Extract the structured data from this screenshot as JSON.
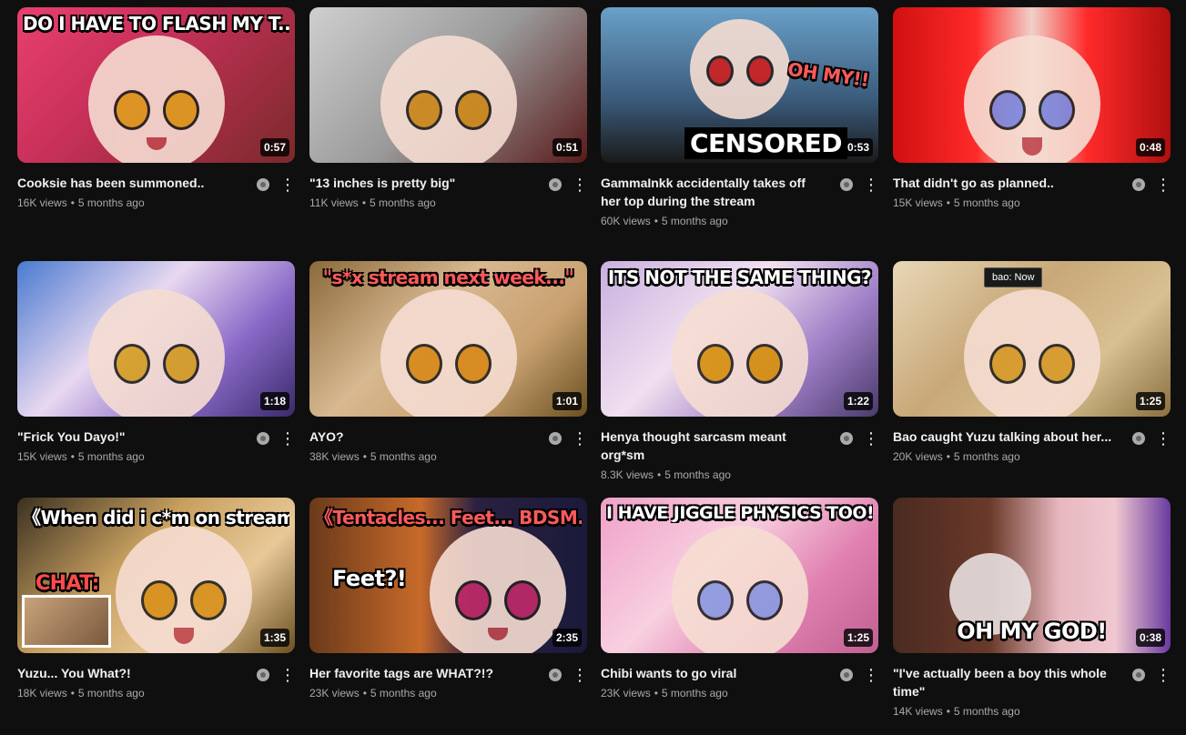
{
  "videos": [
    {
      "title": "Cooksie has been summoned..",
      "views": "16K views",
      "age": "5 months ago",
      "duration": "0:57",
      "caption": "DO I HAVE TO FLASH MY T...?"
    },
    {
      "title": "\"13 inches is pretty big\"",
      "views": "11K views",
      "age": "5 months ago",
      "duration": "0:51",
      "caption": ""
    },
    {
      "title": "GammaInkk accidentally takes off her top during the stream",
      "views": "60K views",
      "age": "5 months ago",
      "duration": "0:53",
      "caption": "OH MY!!",
      "caption2": "CENSORED"
    },
    {
      "title": "That didn't go as planned..",
      "views": "15K views",
      "age": "5 months ago",
      "duration": "0:48",
      "caption": ""
    },
    {
      "title": "\"Frick You Dayo!\"",
      "views": "15K views",
      "age": "5 months ago",
      "duration": "1:18",
      "caption": ""
    },
    {
      "title": "AYO?",
      "views": "38K views",
      "age": "5 months ago",
      "duration": "1:01",
      "caption": "\"s*x stream next week...\""
    },
    {
      "title": "Henya thought sarcasm meant org*sm",
      "views": "8.3K views",
      "age": "5 months ago",
      "duration": "1:22",
      "caption": "ITS NOT THE SAME THING?"
    },
    {
      "title": "Bao caught Yuzu talking about her...",
      "views": "20K views",
      "age": "5 months ago",
      "duration": "1:25",
      "caption": "bao: Now"
    },
    {
      "title": "Yuzu... You What?!",
      "views": "18K views",
      "age": "5 months ago",
      "duration": "1:35",
      "caption": "《When did i c*m on stream?》",
      "caption2": "CHAT:"
    },
    {
      "title": "Her favorite tags are WHAT?!?",
      "views": "23K views",
      "age": "5 months ago",
      "duration": "2:35",
      "caption": "《Tentacles... Feet... BDSM...》",
      "caption2": "Feet?!"
    },
    {
      "title": "Chibi wants to go viral",
      "views": "23K views",
      "age": "5 months ago",
      "duration": "1:25",
      "caption": "I HAVE JIGGLE PHYSICS TOO!"
    },
    {
      "title": "\"I've actually been a boy this whole time\"",
      "views": "14K views",
      "age": "5 months ago",
      "duration": "0:38",
      "caption": "OH MY GOD!"
    }
  ],
  "colors": {
    "background": "#0f0f0f",
    "title": "#f1f1f1",
    "meta": "#aaaaaa"
  },
  "icons": {
    "status": "circle-status-icon",
    "menu": "kebab-menu-icon"
  }
}
